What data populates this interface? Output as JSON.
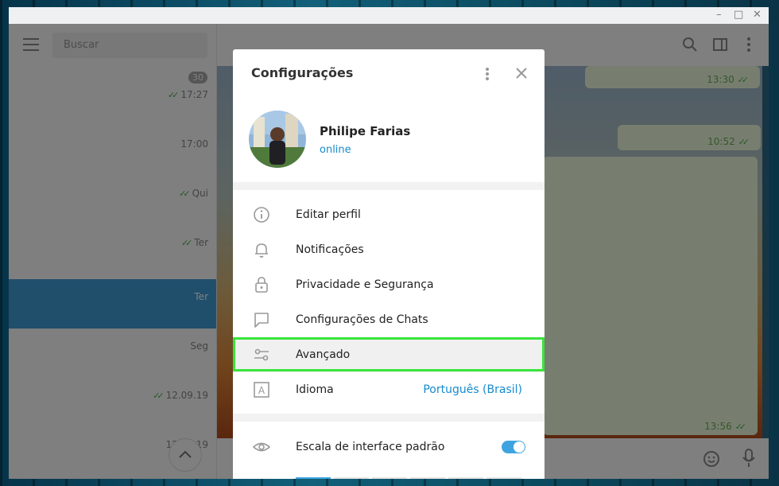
{
  "window": {
    "controls": [
      "–",
      "□",
      "✕"
    ]
  },
  "sidebar": {
    "search_placeholder": "Buscar",
    "unread_badge": "30",
    "chats": [
      {
        "time": "17:27",
        "read": true,
        "active": false
      },
      {
        "time": "17:00",
        "read": false,
        "active": false
      },
      {
        "time": "Qui",
        "read": true,
        "active": false
      },
      {
        "time": "Ter",
        "read": true,
        "active": false
      },
      {
        "time": "Ter",
        "read": false,
        "active": true
      },
      {
        "time": "Seg",
        "read": false,
        "active": false
      },
      {
        "time": "12.09.19",
        "read": true,
        "active": false
      },
      {
        "time": "12.09.19",
        "read": false,
        "active": false
      }
    ]
  },
  "chat": {
    "messages": [
      {
        "time": "13:30"
      },
      {
        "time": "10:52"
      },
      {
        "time": "13:56"
      }
    ]
  },
  "settings": {
    "title": "Configurações",
    "profile": {
      "name": "Philipe Farias",
      "status": "online"
    },
    "menu": [
      {
        "label": "Editar perfil",
        "icon": "info-icon"
      },
      {
        "label": "Notificações",
        "icon": "bell-icon"
      },
      {
        "label": "Privacidade e Segurança",
        "icon": "lock-icon"
      },
      {
        "label": "Configurações de Chats",
        "icon": "chat-bubble-icon"
      },
      {
        "label": "Avançado",
        "icon": "sliders-icon",
        "highlighted": true
      },
      {
        "label": "Idioma",
        "icon": "language-icon",
        "value": "Português (Brasil)"
      }
    ],
    "scale": {
      "label": "Escala de interface padrão",
      "enabled": true,
      "icon": "eye-icon"
    }
  },
  "colors": {
    "accent": "#3ea4df",
    "link": "#168acd",
    "highlight_border": "#39e53b",
    "active_chat": "#419fd9"
  }
}
